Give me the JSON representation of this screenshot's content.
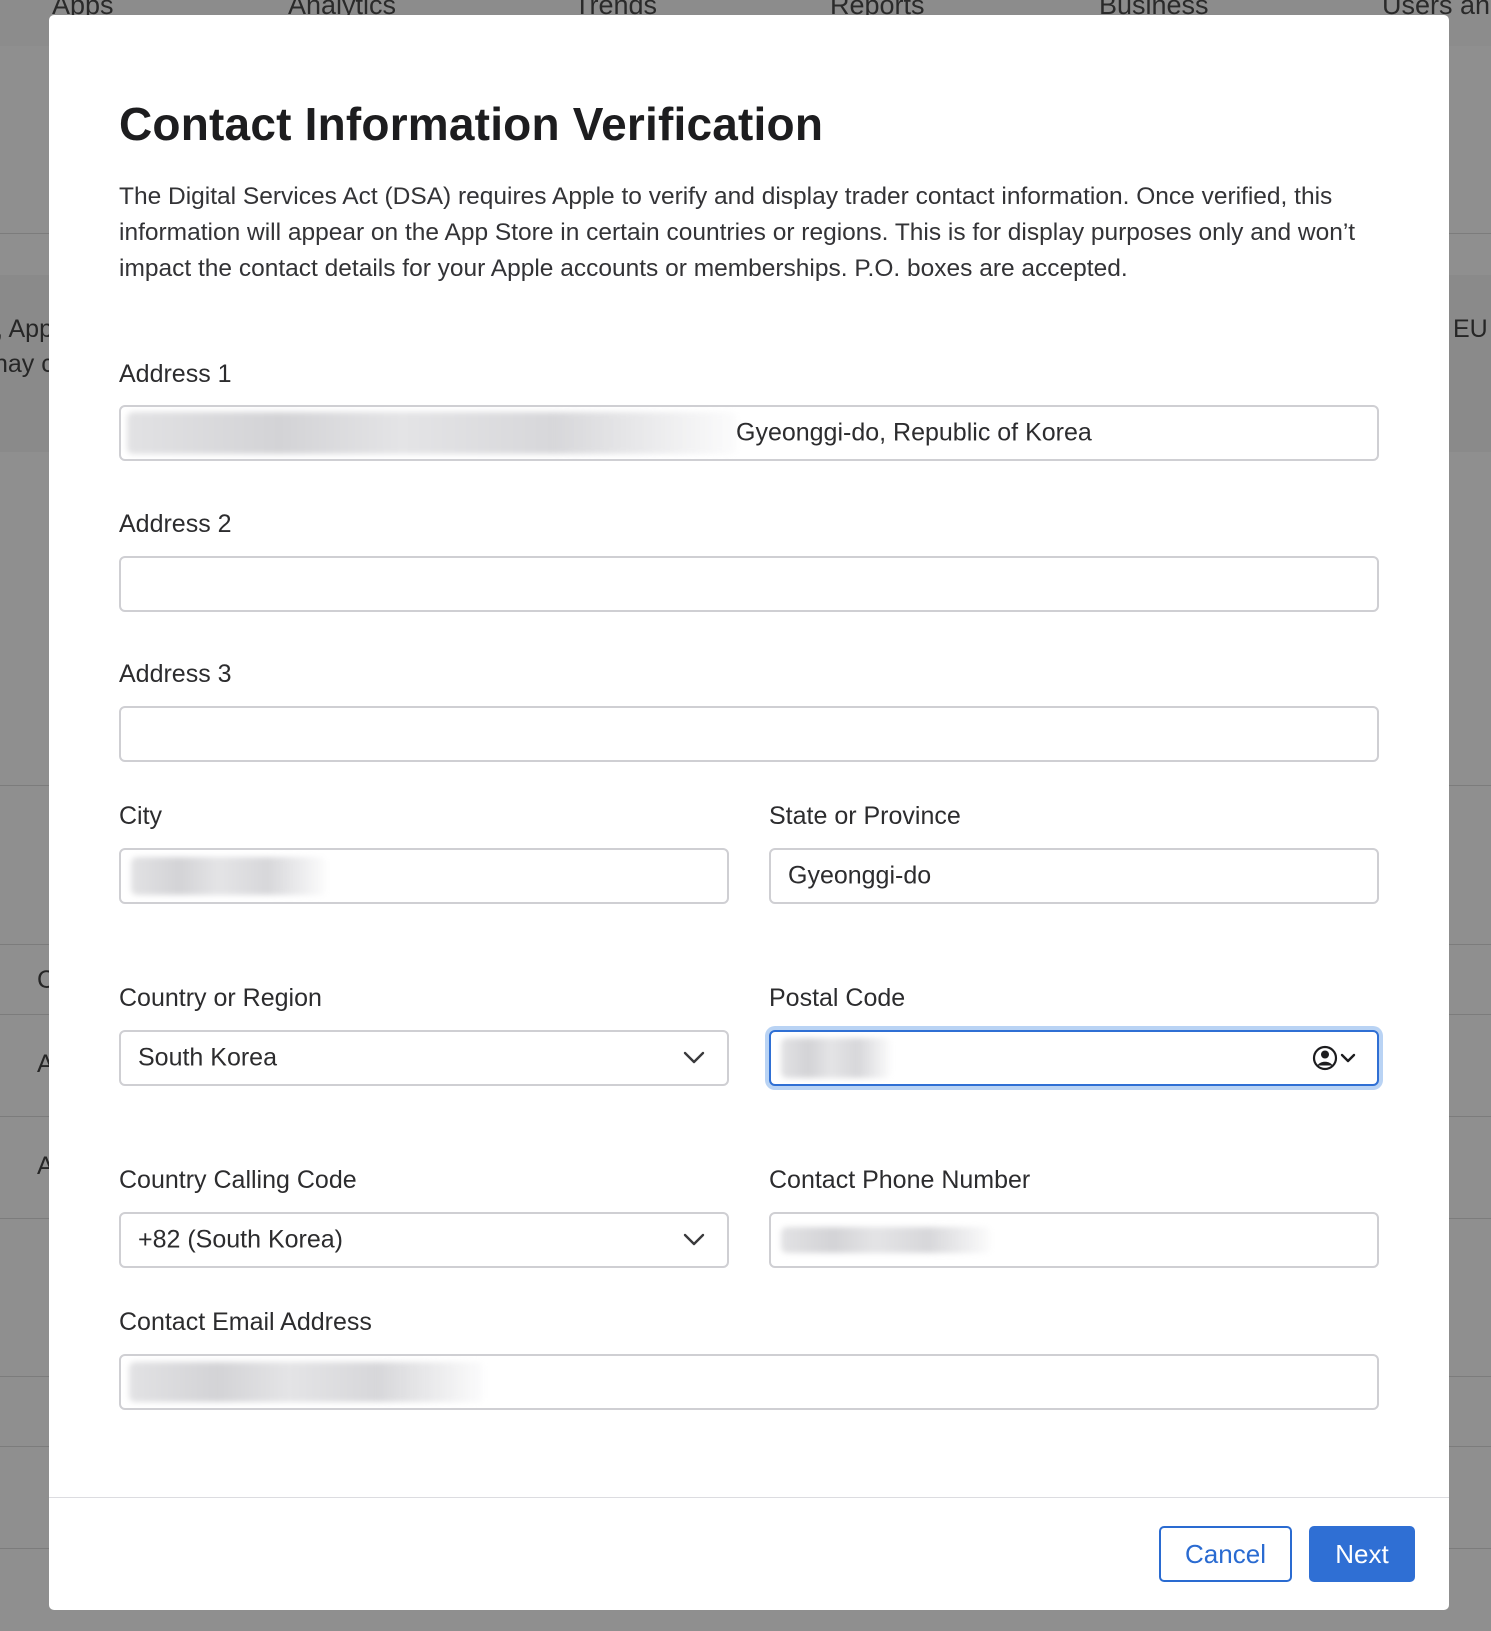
{
  "background": {
    "nav_items": [
      "Apps",
      "Analytics",
      "Trends",
      "Reports",
      "Business",
      "Users an"
    ],
    "left_fragments": [
      ", App",
      "nay c",
      "C",
      "A",
      "A"
    ],
    "right_fragments": [
      "EU"
    ]
  },
  "modal": {
    "title": "Contact Information Verification",
    "description": "The Digital Services Act (DSA) requires Apple to verify and display trader contact information. Once verified, this information will appear on the App Store in certain countries or regions. This is for display purposes only and won’t impact the contact details for your Apple accounts or memberships. P.O. boxes are accepted.",
    "fields": {
      "address1": {
        "label": "Address 1",
        "value": "Gyeonggi-do, Republic of Korea"
      },
      "address2": {
        "label": "Address 2",
        "value": ""
      },
      "address3": {
        "label": "Address 3",
        "value": ""
      },
      "city": {
        "label": "City",
        "value": ""
      },
      "state": {
        "label": "State or Province",
        "value": "Gyeonggi-do"
      },
      "country": {
        "label": "Country or Region",
        "value": "South Korea"
      },
      "postal": {
        "label": "Postal Code",
        "value": ""
      },
      "calling_code": {
        "label": "Country Calling Code",
        "value": "+82 (South Korea)"
      },
      "phone": {
        "label": "Contact Phone Number",
        "value": ""
      },
      "email": {
        "label": "Contact Email Address",
        "value": ""
      }
    },
    "buttons": {
      "cancel": "Cancel",
      "next": "Next"
    }
  },
  "colors": {
    "accent": "#2f6fd4",
    "focus_ring": "#b9d3f4",
    "overlay": "#8f8f8f"
  },
  "icons": {
    "select_chevron": "chevron-down-icon",
    "autofill": "person-circle-icon"
  }
}
